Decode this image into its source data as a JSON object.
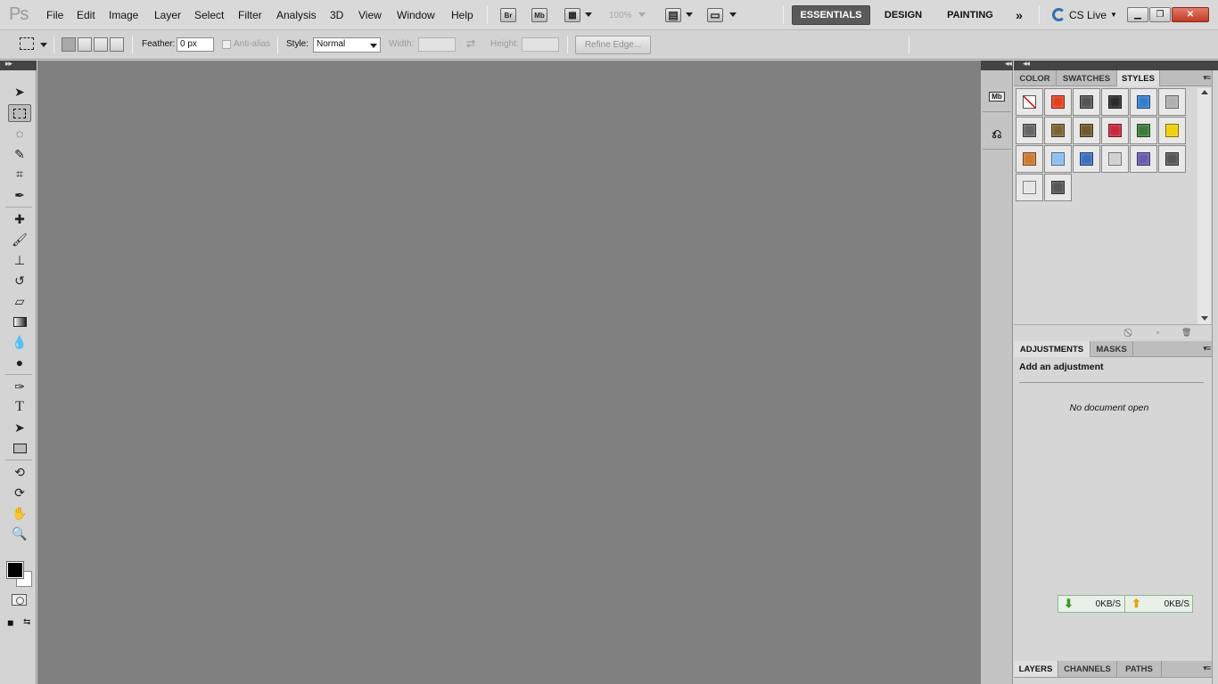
{
  "app": {
    "logo": "Ps"
  },
  "menu": [
    "File",
    "Edit",
    "Image",
    "Layer",
    "Select",
    "Filter",
    "Analysis",
    "3D",
    "View",
    "Window",
    "Help"
  ],
  "appbar": {
    "bridge_label": "Br",
    "minibridge_label": "Mb",
    "zoom": "100%"
  },
  "workspaces": {
    "active": "ESSENTIALS",
    "design": "DESIGN",
    "painting": "PAINTING",
    "more": "»"
  },
  "cs_live": "CS Live",
  "options": {
    "feather_label": "Feather:",
    "feather_value": "0 px",
    "antialias_label": "Anti-alias",
    "style_label": "Style:",
    "style_value": "Normal",
    "width_label": "Width:",
    "height_label": "Height:",
    "refine_edge": "Refine Edge..."
  },
  "styles_panel": {
    "tabs": [
      "COLOR",
      "SWATCHES",
      "STYLES"
    ],
    "active_tab": "STYLES",
    "swatches": [
      "none",
      "#e8401a",
      "#555555",
      "#2b2b2b",
      "#2f7fd1",
      "#b0b0b0",
      "#666666",
      "#7a6432",
      "#705a2a",
      "#c8283a",
      "#3a7a3a",
      "#f0d000",
      "#d07a30",
      "#8cc0f0",
      "#3a70c0",
      "#d0d0d0",
      "#6a5ab0",
      "#555555",
      "#e6e6e6",
      "#555555"
    ]
  },
  "adjustments_panel": {
    "tabs": [
      "ADJUSTMENTS",
      "MASKS"
    ],
    "active_tab": "ADJUSTMENTS",
    "title": "Add an adjustment",
    "empty_message": "No document open"
  },
  "layers_panel": {
    "tabs": [
      "LAYERS",
      "CHANNELS",
      "PATHS"
    ],
    "active_tab": "LAYERS"
  },
  "net_meter": {
    "down": "0KB/S",
    "up": "0KB/S",
    "down_color": "#3a9a1a",
    "up_color": "#f0a000"
  }
}
